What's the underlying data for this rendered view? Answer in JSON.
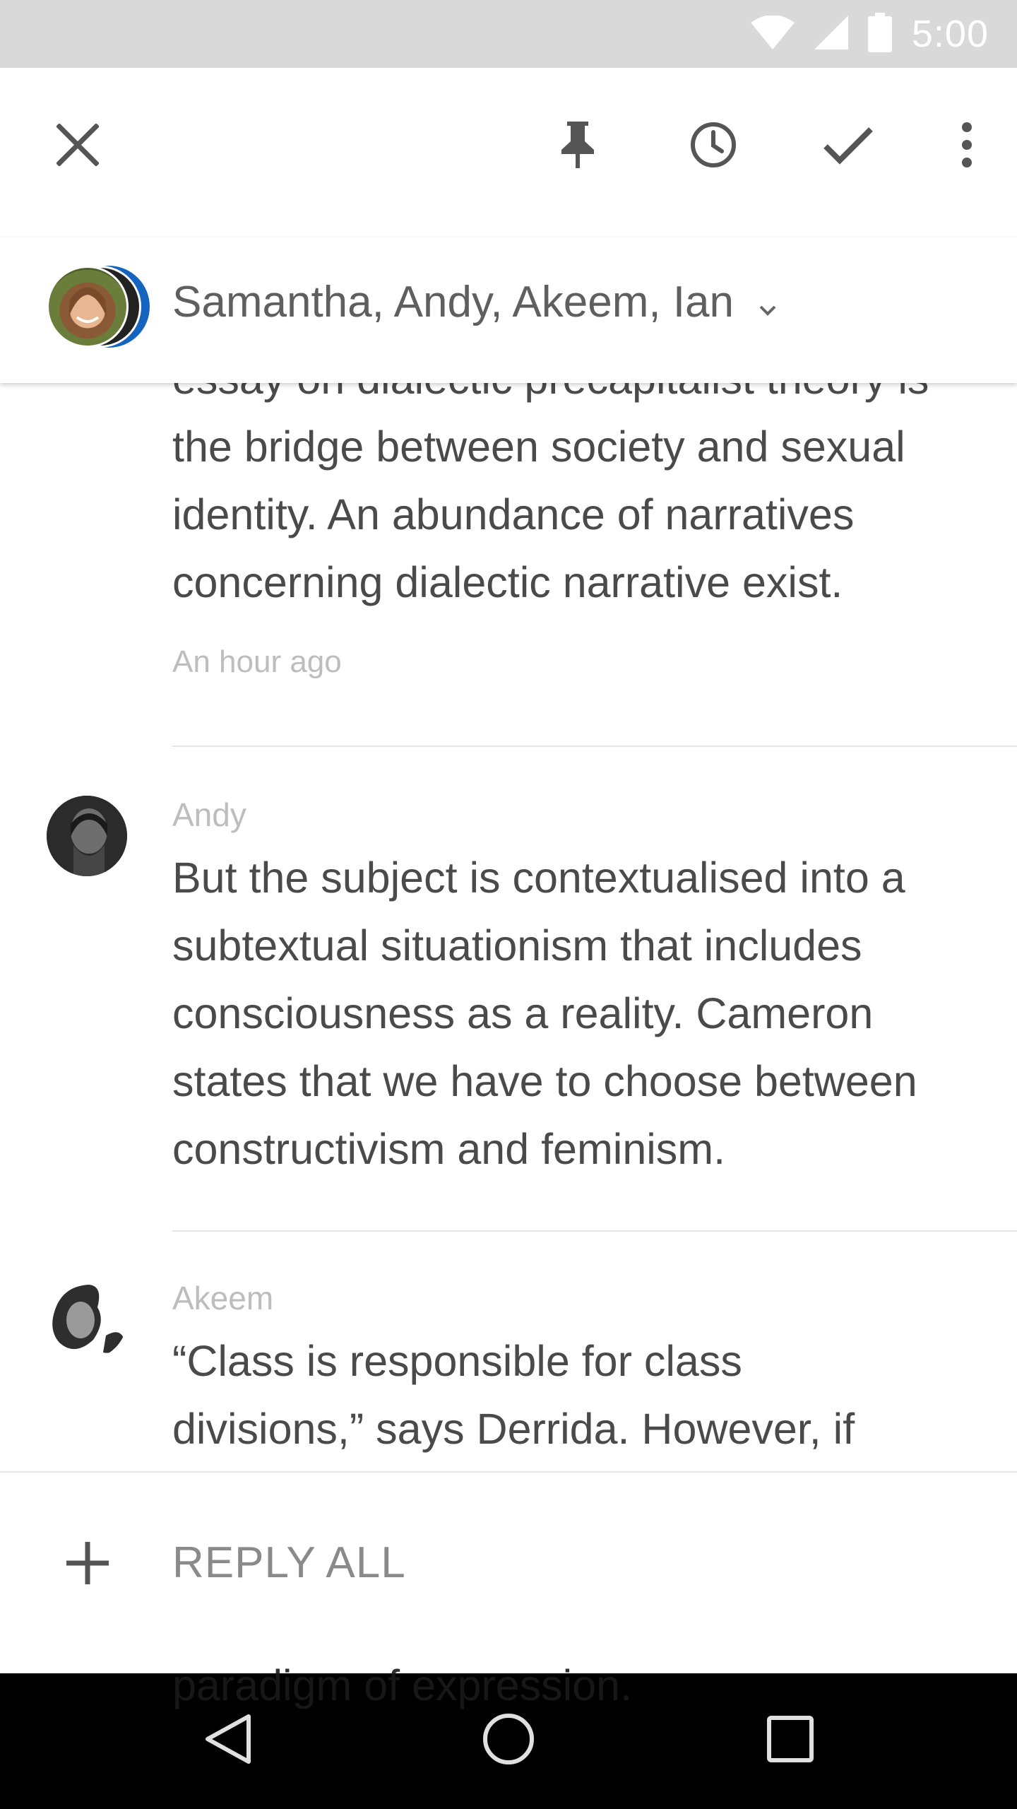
{
  "status_bar": {
    "time": "5:00",
    "icons": [
      "wifi-icon",
      "cellular-signal-icon",
      "battery-icon"
    ]
  },
  "toolbar": {
    "actions": [
      "close-icon",
      "pin-icon",
      "snooze-clock-icon",
      "done-check-icon",
      "more-vert-icon"
    ]
  },
  "conversation": {
    "participants": "Samantha, Andy, Akeem, Ian",
    "messages": [
      {
        "sender": "",
        "text_lines": [
          "essay on dialectic precapitalist theory is",
          "the bridge between society and sexual",
          "identity. An abundance of narratives",
          "concerning dialectic narrative exist."
        ],
        "time": "An hour ago"
      },
      {
        "sender": "Andy",
        "text_lines": [
          "But the subject is contextualised into a",
          "subtextual situationism that includes",
          "consciousness as a reality. Cameron",
          "states that we have to choose between",
          "constructivism and feminism."
        ]
      },
      {
        "sender": "Akeem",
        "text_lines": [
          "“Class is responsible for class",
          "divisions,” says Derrida. However, if"
        ],
        "peek_line": "paradigm of expression."
      }
    ]
  },
  "reply": {
    "label": "REPLY ALL"
  },
  "nav_bar": {
    "buttons": [
      "back-icon",
      "home-icon",
      "recents-icon"
    ]
  },
  "colors": {
    "status_bar_bg": "#d9d9d9",
    "nav_bar_bg": "#000000",
    "secondary_text": "#bdbdbd",
    "body_text": "#4a4a4a"
  }
}
